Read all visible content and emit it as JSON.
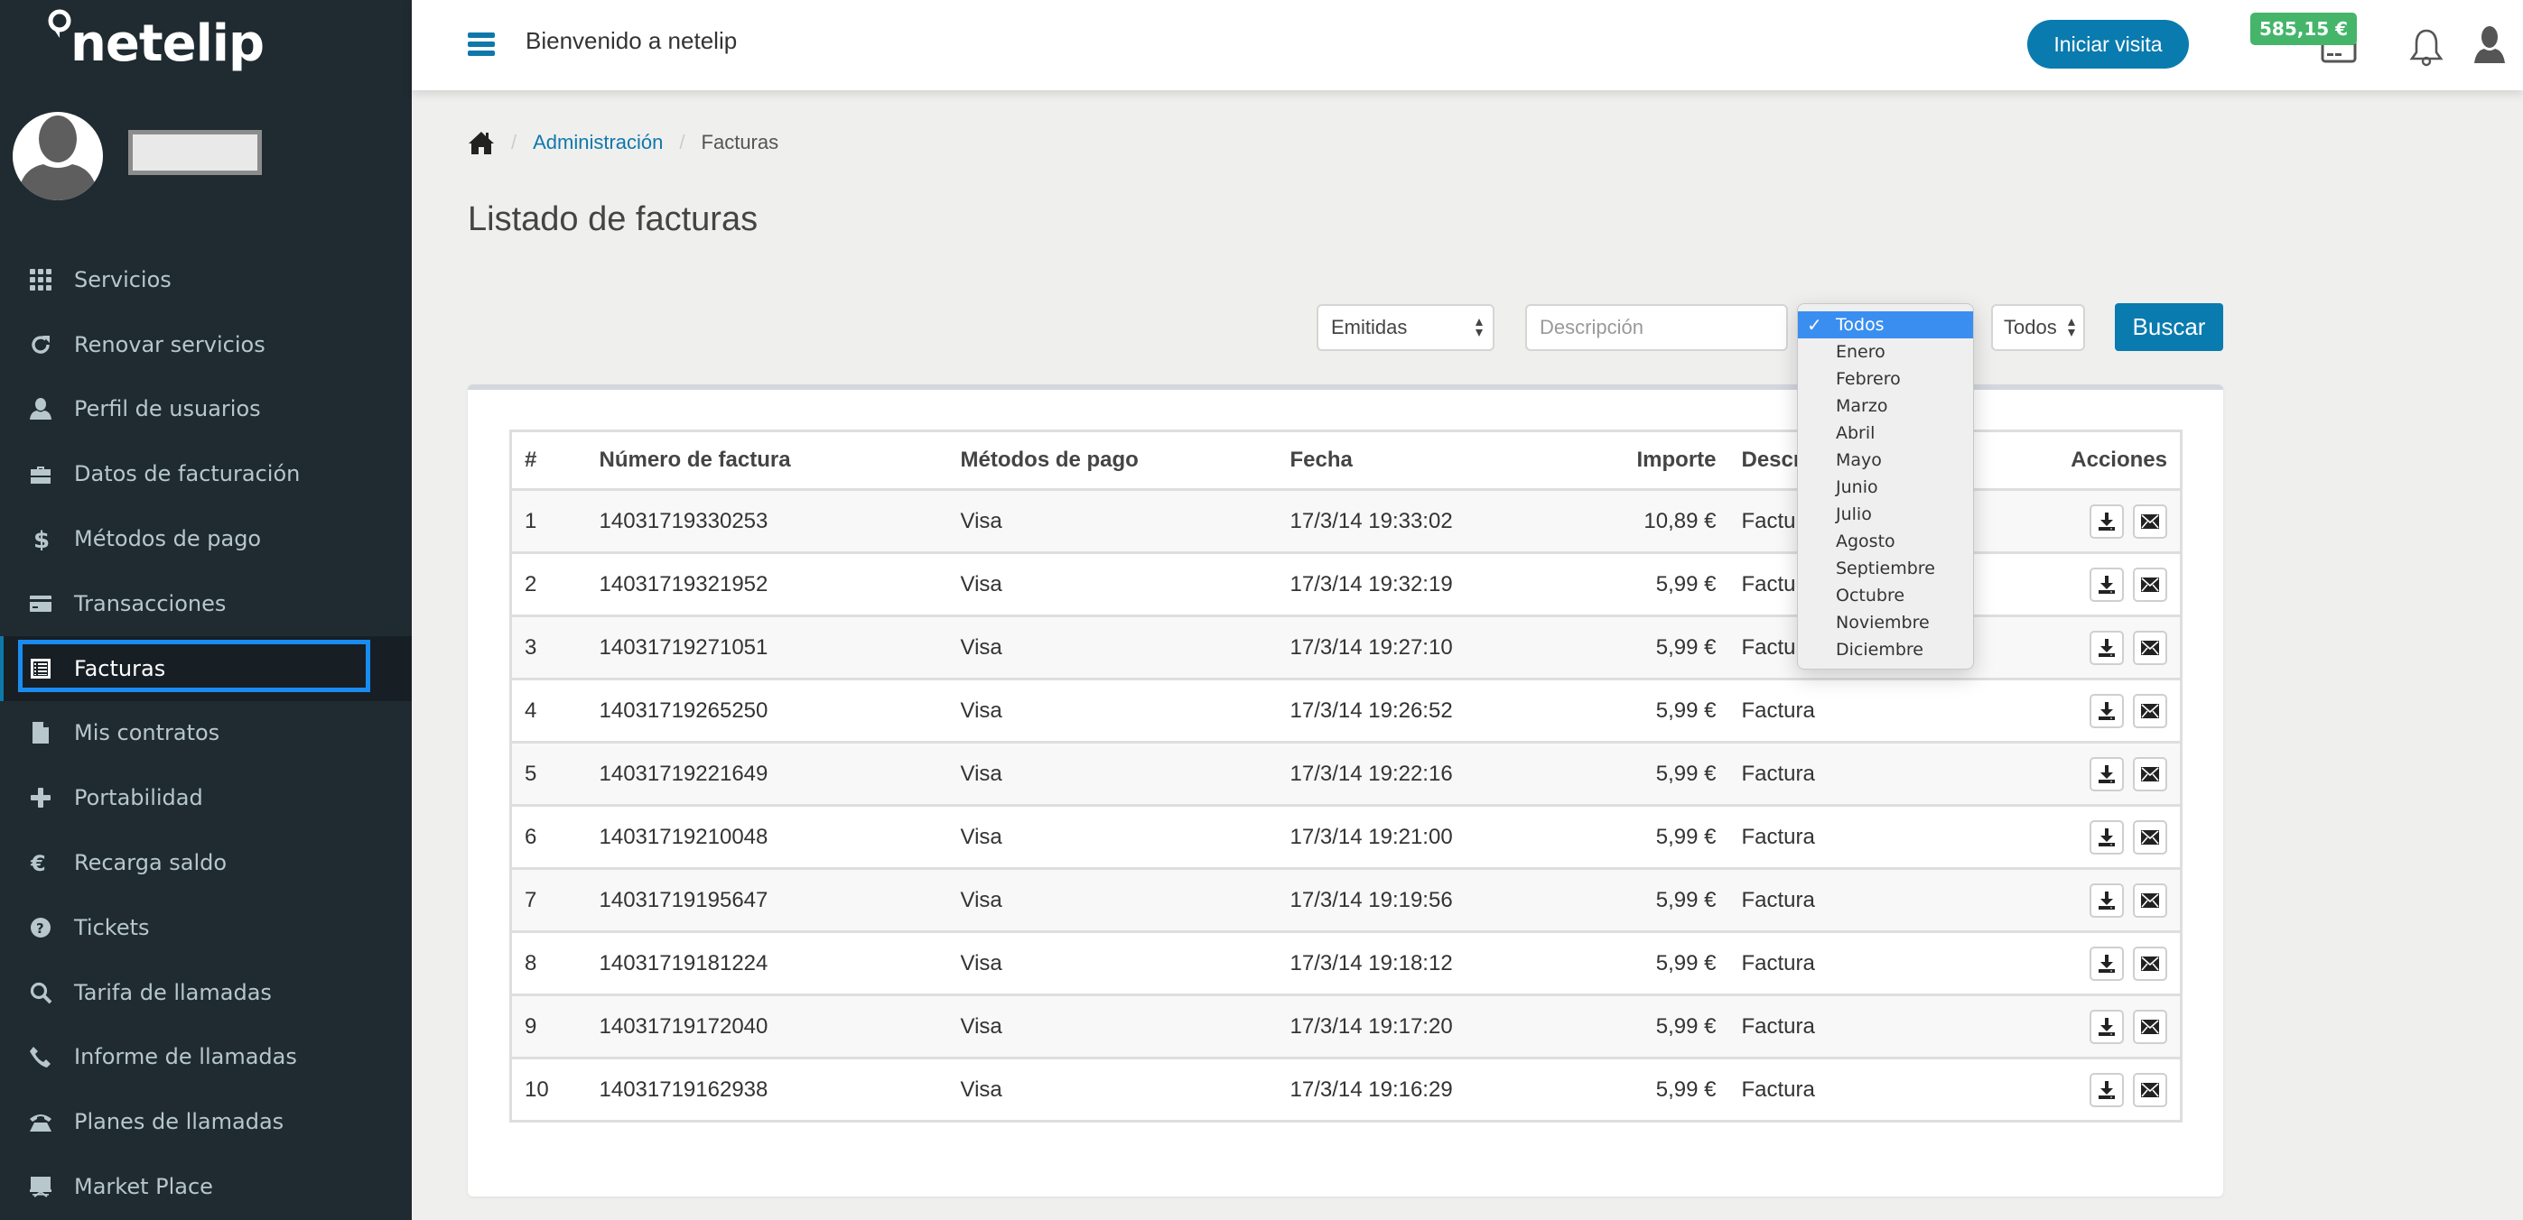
{
  "brand": {
    "name": "netelip"
  },
  "user": {
    "name": ""
  },
  "sidebar": {
    "items": [
      {
        "label": "Servicios",
        "icon": "grid-icon",
        "active": false
      },
      {
        "label": "Renovar servicios",
        "icon": "refresh-icon",
        "active": false
      },
      {
        "label": "Perfil de usuarios",
        "icon": "user-icon",
        "active": false
      },
      {
        "label": "Datos de facturación",
        "icon": "briefcase-icon",
        "active": false
      },
      {
        "label": "Métodos de pago",
        "icon": "dollar-icon",
        "active": false
      },
      {
        "label": "Transacciones",
        "icon": "credit-card-icon",
        "active": false
      },
      {
        "label": "Facturas",
        "icon": "list-alt-icon",
        "active": true
      },
      {
        "label": "Mis contratos",
        "icon": "file-icon",
        "active": false
      },
      {
        "label": "Portabilidad",
        "icon": "plus-icon",
        "active": false
      },
      {
        "label": "Recarga saldo",
        "icon": "euro-icon",
        "active": false
      },
      {
        "label": "Tickets",
        "icon": "question-circle-icon",
        "active": false
      },
      {
        "label": "Tarifa de llamadas",
        "icon": "search-icon",
        "active": false
      },
      {
        "label": "Informe de llamadas",
        "icon": "phone-icon",
        "active": false
      },
      {
        "label": "Planes de llamadas",
        "icon": "phone-alt-icon",
        "active": false
      },
      {
        "label": "Market Place",
        "icon": "blackboard-icon",
        "active": false
      }
    ]
  },
  "topbar": {
    "welcome": "Bienvenido a netelip",
    "visit_button": "Iniciar visita",
    "balance": "585,15 €",
    "colors": {
      "accent": "#0a7baf",
      "balance": "#45b56a"
    }
  },
  "breadcrumb": {
    "items": [
      "Administración",
      "Facturas"
    ]
  },
  "page": {
    "title": "Listado de facturas"
  },
  "filters": {
    "type_select": {
      "value": "Emitidas"
    },
    "description_input": {
      "value": "",
      "placeholder": "Descripción"
    },
    "month_select": {
      "value": "Todos",
      "open": true,
      "options": [
        "Todos",
        "Enero",
        "Febrero",
        "Marzo",
        "Abril",
        "Mayo",
        "Junio",
        "Julio",
        "Agosto",
        "Septiembre",
        "Octubre",
        "Noviembre",
        "Diciembre"
      ]
    },
    "year_select": {
      "value": "Todos"
    },
    "search_button": "Buscar"
  },
  "table": {
    "columns": [
      "#",
      "Número de factura",
      "Métodos de pago",
      "Fecha",
      "Importe",
      "Descripción",
      "Acciones"
    ],
    "rows": [
      {
        "n": "1",
        "invoice": "14031719330253",
        "method": "Visa",
        "date": "17/3/14 19:33:02",
        "amount": "10,89 €",
        "description": "Factura"
      },
      {
        "n": "2",
        "invoice": "14031719321952",
        "method": "Visa",
        "date": "17/3/14 19:32:19",
        "amount": "5,99 €",
        "description": "Factura"
      },
      {
        "n": "3",
        "invoice": "14031719271051",
        "method": "Visa",
        "date": "17/3/14 19:27:10",
        "amount": "5,99 €",
        "description": "Factura"
      },
      {
        "n": "4",
        "invoice": "14031719265250",
        "method": "Visa",
        "date": "17/3/14 19:26:52",
        "amount": "5,99 €",
        "description": "Factura"
      },
      {
        "n": "5",
        "invoice": "14031719221649",
        "method": "Visa",
        "date": "17/3/14 19:22:16",
        "amount": "5,99 €",
        "description": "Factura"
      },
      {
        "n": "6",
        "invoice": "14031719210048",
        "method": "Visa",
        "date": "17/3/14 19:21:00",
        "amount": "5,99 €",
        "description": "Factura"
      },
      {
        "n": "7",
        "invoice": "14031719195647",
        "method": "Visa",
        "date": "17/3/14 19:19:56",
        "amount": "5,99 €",
        "description": "Factura"
      },
      {
        "n": "8",
        "invoice": "14031719181224",
        "method": "Visa",
        "date": "17/3/14 19:18:12",
        "amount": "5,99 €",
        "description": "Factura"
      },
      {
        "n": "9",
        "invoice": "14031719172040",
        "method": "Visa",
        "date": "17/3/14 19:17:20",
        "amount": "5,99 €",
        "description": "Factura"
      },
      {
        "n": "10",
        "invoice": "14031719162938",
        "method": "Visa",
        "date": "17/3/14 19:16:29",
        "amount": "5,99 €",
        "description": "Factura"
      }
    ],
    "row_actions": [
      "download-icon",
      "envelope-icon"
    ]
  }
}
